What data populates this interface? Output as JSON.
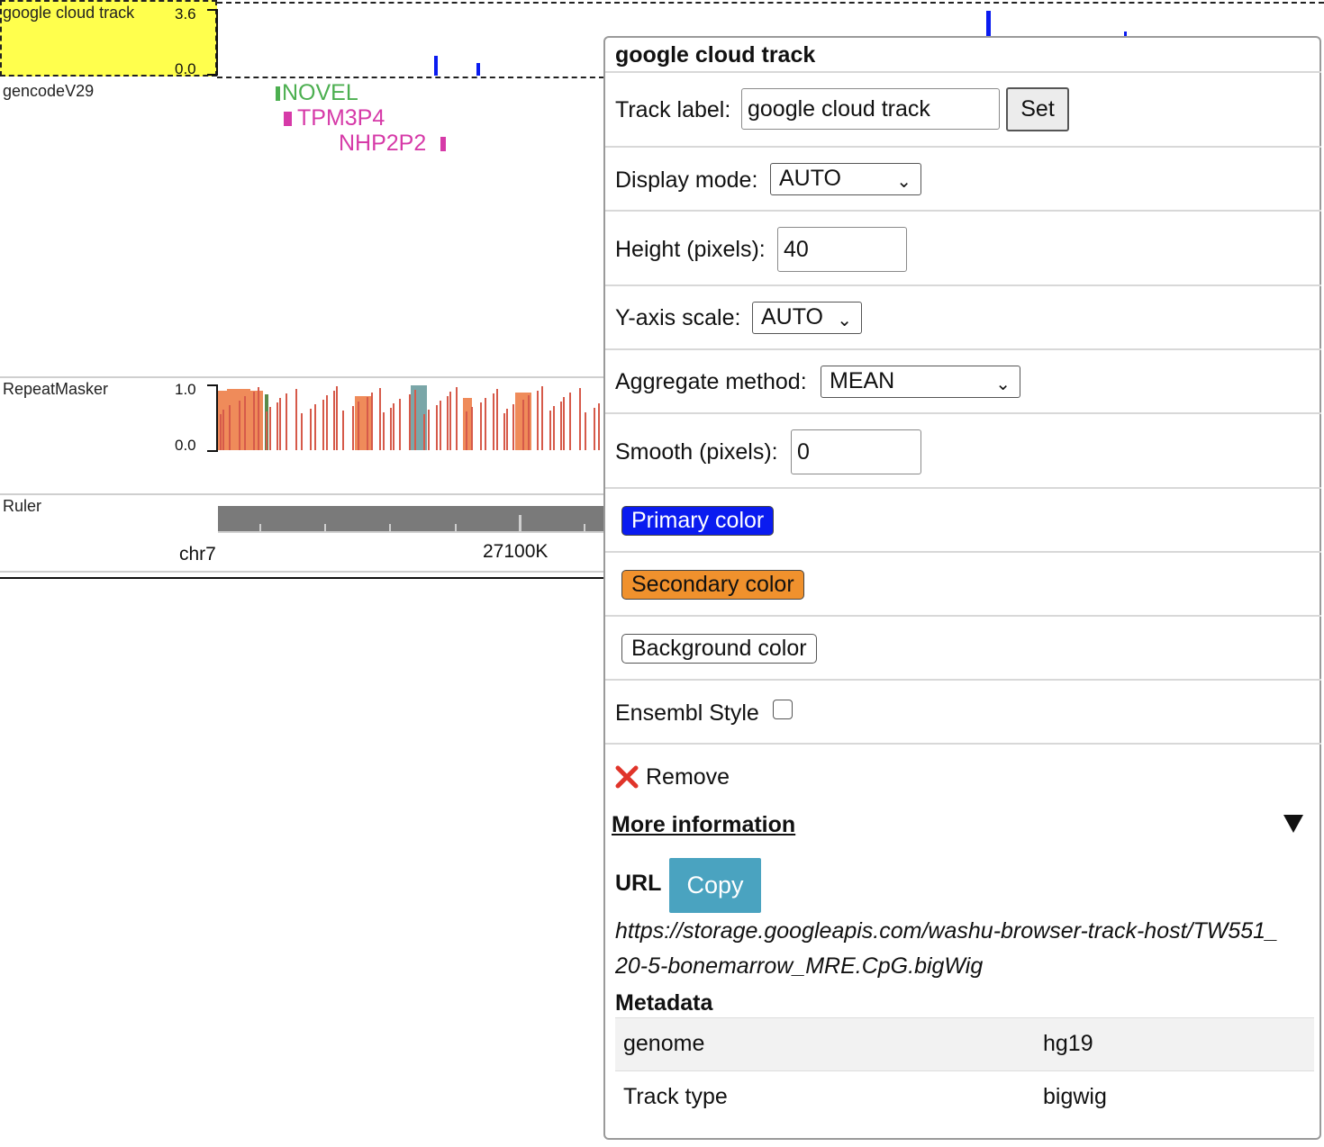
{
  "tracks": {
    "google_cloud": {
      "label": "google cloud track",
      "axis_max": "3.6",
      "axis_min": "0.0"
    },
    "gencode": {
      "label": "gencodeV29",
      "genes": [
        "NOVEL",
        "TPM3P4",
        "NHP2P2"
      ],
      "gene_colors": {
        "novel": "#4caf50",
        "other": "#d63aa8"
      }
    },
    "repeatmasker": {
      "label": "RepeatMasker",
      "axis_max": "1.0",
      "axis_min": "0.0"
    },
    "ruler": {
      "label": "Ruler",
      "chrom": "chr7",
      "position": "27100K"
    }
  },
  "panel": {
    "title": "google cloud track",
    "track_label": {
      "label": "Track label:",
      "value": "google cloud track",
      "button": "Set"
    },
    "display_mode": {
      "label": "Display mode:",
      "value": "AUTO"
    },
    "height": {
      "label": "Height (pixels):",
      "value": "40"
    },
    "y_axis_scale": {
      "label": "Y-axis scale:",
      "value": "AUTO"
    },
    "aggregate": {
      "label": "Aggregate method:",
      "value": "MEAN"
    },
    "smooth": {
      "label": "Smooth (pixels):",
      "value": "0"
    },
    "primary_color": {
      "label": "Primary color",
      "color": "#0a1bf0"
    },
    "secondary_color": {
      "label": "Secondary color",
      "color": "#f0912d"
    },
    "background_color": {
      "label": "Background color",
      "color": "#ffffff"
    },
    "ensembl_style": {
      "label": "Ensembl Style",
      "checked": false
    },
    "remove": {
      "label": "Remove"
    },
    "more_info": {
      "label": "More information",
      "url_label": "URL",
      "copy_button": "Copy",
      "url_line1": "https://storage.googleapis.com/washu-browser-track-host/TW551_",
      "url_line2": "20-5-bonemarrow_MRE.CpG.bigWig",
      "metadata_label": "Metadata",
      "metadata": [
        {
          "key": "genome",
          "value": "hg19"
        },
        {
          "key": "Track type",
          "value": "bigwig"
        }
      ]
    }
  }
}
